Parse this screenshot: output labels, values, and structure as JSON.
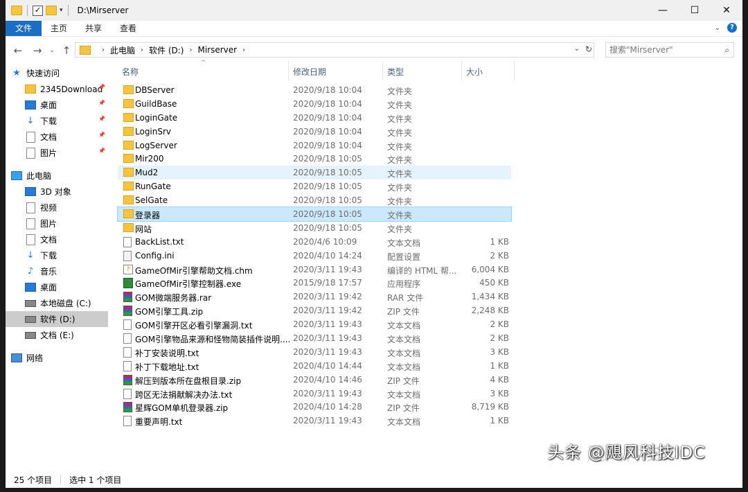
{
  "window": {
    "title": "D:\\Mirserver",
    "controls": [
      "—",
      "☐",
      "✕"
    ]
  },
  "ribbon": {
    "tabs": [
      "文件",
      "主页",
      "共享",
      "查看"
    ]
  },
  "address": {
    "crumbs": [
      "此电脑",
      "软件 (D:)",
      "Mirserver"
    ],
    "search_placeholder": "搜索\"Mirserver\""
  },
  "sidebar": {
    "items": [
      {
        "label": "快速访问",
        "icon": "star-icon"
      },
      {
        "label": "2345Download",
        "icon": "folder-icon",
        "pinned": true
      },
      {
        "label": "桌面",
        "icon": "desktop-icon",
        "pinned": true
      },
      {
        "label": "下载",
        "icon": "download-icon",
        "pinned": true
      },
      {
        "label": "文档",
        "icon": "document-icon",
        "pinned": true
      },
      {
        "label": "图片",
        "icon": "pictures-icon",
        "pinned": true
      },
      {
        "label": "此电脑",
        "icon": "computer-icon"
      },
      {
        "label": "3D 对象",
        "icon": "3d-objects-icon"
      },
      {
        "label": "视频",
        "icon": "video-icon"
      },
      {
        "label": "图片",
        "icon": "pictures-icon"
      },
      {
        "label": "文档",
        "icon": "document-icon"
      },
      {
        "label": "下载",
        "icon": "download-icon"
      },
      {
        "label": "音乐",
        "icon": "music-icon"
      },
      {
        "label": "桌面",
        "icon": "desktop-icon"
      },
      {
        "label": "本地磁盘 (C:)",
        "icon": "drive-icon"
      },
      {
        "label": "软件 (D:)",
        "icon": "drive-icon",
        "selected": true
      },
      {
        "label": "文档 (E:)",
        "icon": "drive-icon"
      },
      {
        "label": "网络",
        "icon": "network-icon"
      }
    ]
  },
  "columns": {
    "name": "名称",
    "date": "修改日期",
    "type": "类型",
    "size": "大小"
  },
  "files": [
    {
      "name": "DBServer",
      "date": "2020/9/18 10:04",
      "type": "文件夹",
      "size": "",
      "kind": "folder"
    },
    {
      "name": "GuildBase",
      "date": "2020/9/18 10:04",
      "type": "文件夹",
      "size": "",
      "kind": "folder"
    },
    {
      "name": "LoginGate",
      "date": "2020/9/18 10:04",
      "type": "文件夹",
      "size": "",
      "kind": "folder"
    },
    {
      "name": "LoginSrv",
      "date": "2020/9/18 10:04",
      "type": "文件夹",
      "size": "",
      "kind": "folder"
    },
    {
      "name": "LogServer",
      "date": "2020/9/18 10:04",
      "type": "文件夹",
      "size": "",
      "kind": "folder"
    },
    {
      "name": "Mir200",
      "date": "2020/9/18 10:05",
      "type": "文件夹",
      "size": "",
      "kind": "folder"
    },
    {
      "name": "Mud2",
      "date": "2020/9/18 10:05",
      "type": "文件夹",
      "size": "",
      "kind": "folder",
      "hover": true
    },
    {
      "name": "RunGate",
      "date": "2020/9/18 10:05",
      "type": "文件夹",
      "size": "",
      "kind": "folder"
    },
    {
      "name": "SelGate",
      "date": "2020/9/18 10:05",
      "type": "文件夹",
      "size": "",
      "kind": "folder"
    },
    {
      "name": "登录器",
      "date": "2020/9/18 10:05",
      "type": "文件夹",
      "size": "",
      "kind": "folder",
      "selected": true
    },
    {
      "name": "网站",
      "date": "2020/9/18 10:05",
      "type": "文件夹",
      "size": "",
      "kind": "folder"
    },
    {
      "name": "BackList.txt",
      "date": "2020/4/6 10:09",
      "type": "文本文档",
      "size": "1 KB",
      "kind": "txt"
    },
    {
      "name": "Config.ini",
      "date": "2020/4/10 14:24",
      "type": "配置设置",
      "size": "2 KB",
      "kind": "ini"
    },
    {
      "name": "GameOfMir引擎帮助文档.chm",
      "date": "2020/3/11 19:43",
      "type": "编译的 HTML 帮...",
      "size": "6,004 KB",
      "kind": "chm"
    },
    {
      "name": "GameOfMir引擎控制器.exe",
      "date": "2015/9/18 17:57",
      "type": "应用程序",
      "size": "450 KB",
      "kind": "exe"
    },
    {
      "name": "GOM微端服务器.rar",
      "date": "2020/3/11 19:42",
      "type": "RAR 文件",
      "size": "1,434 KB",
      "kind": "rar"
    },
    {
      "name": "GOM引擎工具.zip",
      "date": "2020/3/11 19:42",
      "type": "ZIP 文件",
      "size": "2,248 KB",
      "kind": "rar"
    },
    {
      "name": "GOM引擎开区必看引擎漏洞.txt",
      "date": "2020/3/11 19:43",
      "type": "文本文档",
      "size": "2 KB",
      "kind": "txt"
    },
    {
      "name": "GOM引擎物品来源和怪物简装插件说明....",
      "date": "2020/3/11 19:43",
      "type": "文本文档",
      "size": "2 KB",
      "kind": "txt"
    },
    {
      "name": "补丁安装说明.txt",
      "date": "2020/3/11 19:43",
      "type": "文本文档",
      "size": "3 KB",
      "kind": "txt"
    },
    {
      "name": "补丁下载地址.txt",
      "date": "2020/4/10 14:44",
      "type": "文本文档",
      "size": "1 KB",
      "kind": "txt"
    },
    {
      "name": "解压到版本所在盘根目录.zip",
      "date": "2020/4/10 14:46",
      "type": "ZIP 文件",
      "size": "4 KB",
      "kind": "rar"
    },
    {
      "name": "跨区无法捐献解决办法.txt",
      "date": "2020/3/11 19:43",
      "type": "文本文档",
      "size": "3 KB",
      "kind": "txt"
    },
    {
      "name": "星辉GOM单机登录器.zip",
      "date": "2020/4/10 14:28",
      "type": "ZIP 文件",
      "size": "8,719 KB",
      "kind": "rar"
    },
    {
      "name": "重要声明.txt",
      "date": "2020/3/11 19:43",
      "type": "文本文档",
      "size": "1 KB",
      "kind": "txt"
    }
  ],
  "status": {
    "count": "25 个项目",
    "selected": "选中 1 个项目"
  },
  "watermark": {
    "text": "头条 @飓风科技IDC",
    "faint": "飓风科技IDC"
  }
}
